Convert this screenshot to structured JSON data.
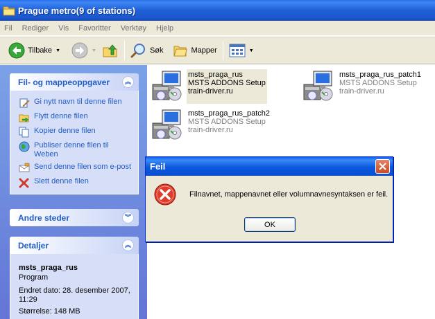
{
  "window": {
    "title": "Prague metro(9 of stations)"
  },
  "menu": [
    "Fil",
    "Rediger",
    "Vis",
    "Favoritter",
    "Verktøy",
    "Hjelp"
  ],
  "toolbar": {
    "back_label": "Tilbake",
    "search_label": "Søk",
    "folders_label": "Mapper"
  },
  "tasks_panel": {
    "title": "Fil- og mappeoppgaver",
    "items": [
      {
        "label": "Gi nytt navn til denne filen",
        "icon": "rename-icon"
      },
      {
        "label": "Flytt denne filen",
        "icon": "move-icon"
      },
      {
        "label": "Kopier denne filen",
        "icon": "copy-icon"
      },
      {
        "label": "Publiser denne filen til Weben",
        "icon": "publish-icon"
      },
      {
        "label": "Send denne filen som e-post",
        "icon": "email-icon"
      },
      {
        "label": "Slett denne filen",
        "icon": "delete-icon"
      }
    ]
  },
  "other_places": {
    "title": "Andre steder"
  },
  "details": {
    "title": "Detaljer",
    "name": "msts_praga_rus",
    "type": "Program",
    "modified": "Endret dato: 28. desember 2007, 11:29",
    "size": "Størrelse: 148 MB"
  },
  "files": [
    {
      "name": "msts_praga_rus",
      "desc": "MSTS ADDONS Setup",
      "company": "train-driver.ru"
    },
    {
      "name": "msts_praga_rus_patch1",
      "desc": "MSTS ADDONS Setup",
      "company": "train-driver.ru"
    },
    {
      "name": "msts_praga_rus_patch2",
      "desc": "MSTS ADDONS Setup",
      "company": "train-driver.ru"
    }
  ],
  "dialog": {
    "title": "Feil",
    "message": "Filnavnet, mappenavnet eller volumnavnesyntaksen er feil.",
    "ok_label": "OK"
  }
}
